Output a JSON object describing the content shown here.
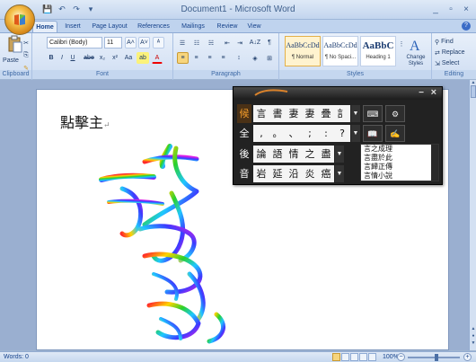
{
  "window": {
    "title": "Document1 - Microsoft Word",
    "minimize": "_",
    "maximize": "▫",
    "close": "×"
  },
  "qat": {
    "save": "💾",
    "undo": "↶",
    "redo": "↷",
    "more": "▾"
  },
  "tabs": [
    "Home",
    "Insert",
    "Page Layout",
    "References",
    "Mailings",
    "Review",
    "View"
  ],
  "help": "?",
  "ribbon": {
    "clipboard": {
      "label": "Clipboard",
      "paste": "Paste"
    },
    "font": {
      "label": "Font",
      "family": "Calibri (Body)",
      "size": "11",
      "grow": "A˄",
      "shrink": "A˅",
      "clear": "ᴬ",
      "bold": "B",
      "italic": "I",
      "underline": "U",
      "strike": "abe",
      "subscript": "x₂",
      "superscript": "x²",
      "case": "Aa",
      "highlight": "ab",
      "color": "A"
    },
    "paragraph": {
      "label": "Paragraph",
      "sort": "A↓Z",
      "show": "¶"
    },
    "styles": {
      "label": "Styles",
      "items": [
        {
          "sample": "AaBbCcDd",
          "name": "¶ Normal"
        },
        {
          "sample": "AaBbCcDd",
          "name": "¶ No Spaci..."
        },
        {
          "sample": "AaBbC",
          "name": "Heading 1"
        }
      ],
      "change": "Change Styles"
    },
    "editing": {
      "label": "Editing",
      "find": "Find",
      "replace": "Replace",
      "select": "Select"
    }
  },
  "document": {
    "text": "點擊主",
    "para_mark": "↵"
  },
  "status": {
    "words": "Words: 0",
    "zoom": "100%",
    "zoom_out": "−",
    "zoom_in": "+"
  },
  "ime": {
    "row1_key": "候",
    "row1": [
      "言",
      "書",
      "妻",
      "妻",
      "疊",
      "訁"
    ],
    "row2_key": "全",
    "row2": [
      ",",
      "。",
      "、",
      ";",
      ":",
      "?"
    ],
    "row3_key": "後",
    "row3": [
      "論",
      "語",
      "情",
      "之",
      "盡"
    ],
    "row4_key": "音",
    "row4": [
      "岩",
      "延",
      "沿",
      "炎",
      "癌"
    ],
    "list": [
      "言之成理",
      "言盡於此",
      "言歸正傳",
      "言情小說"
    ],
    "arrow": "▼",
    "min": "−",
    "close": "×"
  }
}
